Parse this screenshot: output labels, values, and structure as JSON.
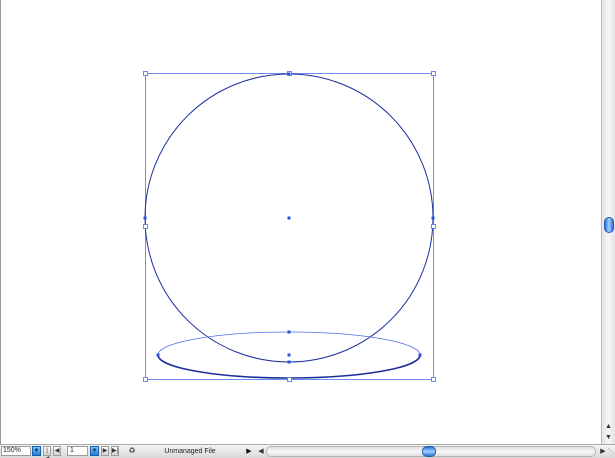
{
  "statusbar": {
    "zoom_value": "150%",
    "zoom_dropdown_icon": "triangle-down-icon",
    "first_page_icon": "first-page-icon",
    "prev_page_icon": "prev-page-icon",
    "page_number": "1",
    "page_dropdown_icon": "triangle-down-icon",
    "next_page_icon": "next-page-icon",
    "last_page_icon": "last-page-icon",
    "document_status_icon": "version-cue-icon",
    "status_text": "Unmanaged File",
    "status_menu_icon": "triangle-right-icon",
    "scroll_left_icon": "triangle-left-icon",
    "scroll_right_icon": "triangle-right-icon"
  },
  "colors": {
    "selection_blue": "#4a6fe8",
    "path_navy": "#1b2f9e",
    "anchor_blue": "#2a52d9",
    "thumb_blue": "#2a73d6"
  }
}
